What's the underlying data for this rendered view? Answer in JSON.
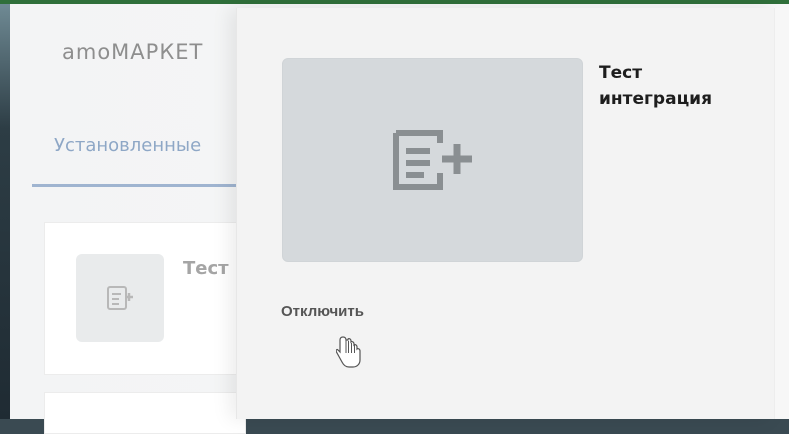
{
  "background": {
    "app_title": "amoМАРКЕТ",
    "tabs": [
      {
        "label": "Установленные"
      }
    ],
    "card": {
      "title": "Тест и"
    }
  },
  "modal": {
    "integration_title": "Тест интеграция",
    "disable_label": "Отключить"
  },
  "icons": {
    "preview": "list-add-icon",
    "card": "list-add-icon",
    "cursor": "hand-pointer-icon"
  },
  "colors": {
    "accent": "#8ea7c6",
    "top_bar": "#2f6f3a"
  }
}
